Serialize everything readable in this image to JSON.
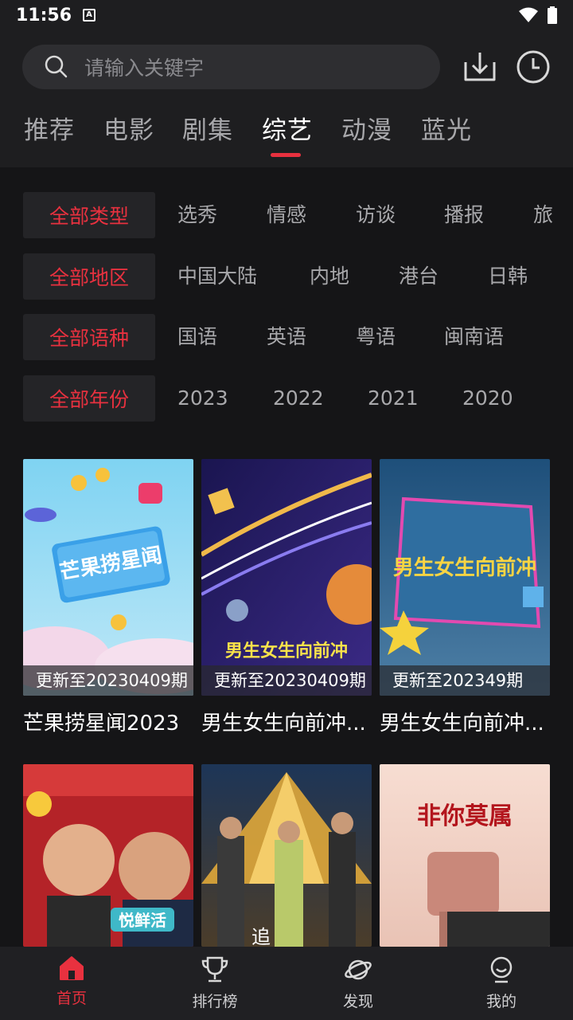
{
  "status": {
    "time": "11:56",
    "notif_letter": "A"
  },
  "search": {
    "placeholder": "请输入关键字"
  },
  "icons": {
    "search": "search-icon",
    "download": "download-icon",
    "history": "clock-icon"
  },
  "tabs": [
    {
      "label": "推荐",
      "active": false
    },
    {
      "label": "电影",
      "active": false
    },
    {
      "label": "剧集",
      "active": false
    },
    {
      "label": "综艺",
      "active": true
    },
    {
      "label": "动漫",
      "active": false
    },
    {
      "label": "蓝光",
      "active": false
    }
  ],
  "filters": {
    "type": {
      "all": "全部类型",
      "options": [
        "选秀",
        "情感",
        "访谈",
        "播报",
        "旅"
      ]
    },
    "region": {
      "all": "全部地区",
      "options": [
        "中国大陆",
        "内地",
        "港台",
        "日韩"
      ]
    },
    "language": {
      "all": "全部语种",
      "options": [
        "国语",
        "英语",
        "粤语",
        "闽南语"
      ]
    },
    "year": {
      "all": "全部年份",
      "options": [
        "2023",
        "2022",
        "2021",
        "2020"
      ]
    }
  },
  "cards": [
    {
      "title": "芒果捞星闻2023",
      "badge": "更新至20230409期",
      "poster_text": "芒果捞星闻"
    },
    {
      "title": "男生女生向前冲...",
      "badge": "更新至20230409期",
      "poster_text": "男生女生向前冲"
    },
    {
      "title": "男生女生向前冲...",
      "badge": "更新至202349期",
      "poster_text": "男生女生向前冲"
    },
    {
      "title": "",
      "badge": "",
      "poster_text": "悦鲜活"
    },
    {
      "title": "",
      "badge": "",
      "poster_text": "追"
    },
    {
      "title": "",
      "badge": "",
      "poster_text": "非你莫属"
    }
  ],
  "nav": [
    {
      "label": "首页",
      "icon": "home-icon",
      "active": true
    },
    {
      "label": "排行榜",
      "icon": "trophy-icon",
      "active": false
    },
    {
      "label": "发现",
      "icon": "planet-icon",
      "active": false
    },
    {
      "label": "我的",
      "icon": "user-icon",
      "active": false
    }
  ],
  "colors": {
    "accent": "#e8313f",
    "background": "#151517",
    "header": "#1e1e20"
  }
}
